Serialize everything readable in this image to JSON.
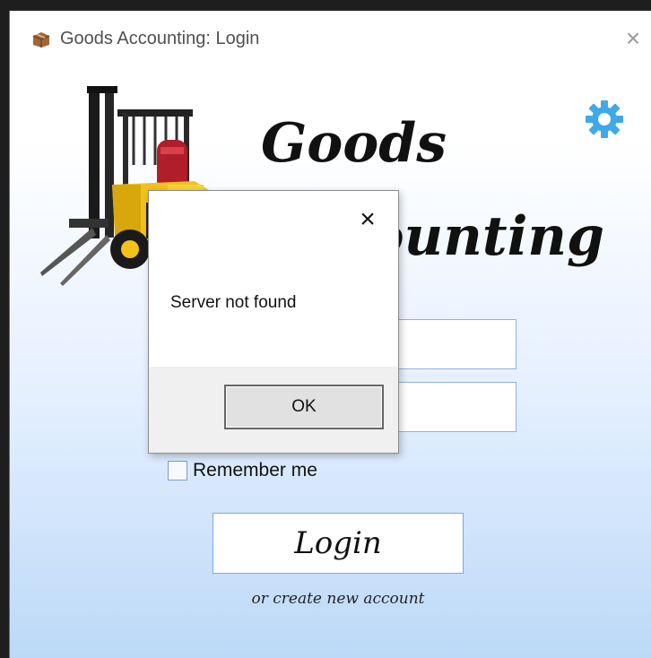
{
  "window": {
    "title": "Goods Accounting: Login",
    "close_glyph": "×"
  },
  "app": {
    "title_line1": "Goods",
    "title_line2": "Accounting",
    "settings_icon": "gear-icon",
    "accent_color": "#3fa9e8"
  },
  "form": {
    "username_value": "",
    "password_value": "",
    "remember_label": "Remember me",
    "remember_checked": false,
    "login_label": "Login",
    "create_account_label": "or create new account"
  },
  "dialog": {
    "message": "Server not found",
    "ok_label": "OK",
    "close_glyph": "×"
  }
}
